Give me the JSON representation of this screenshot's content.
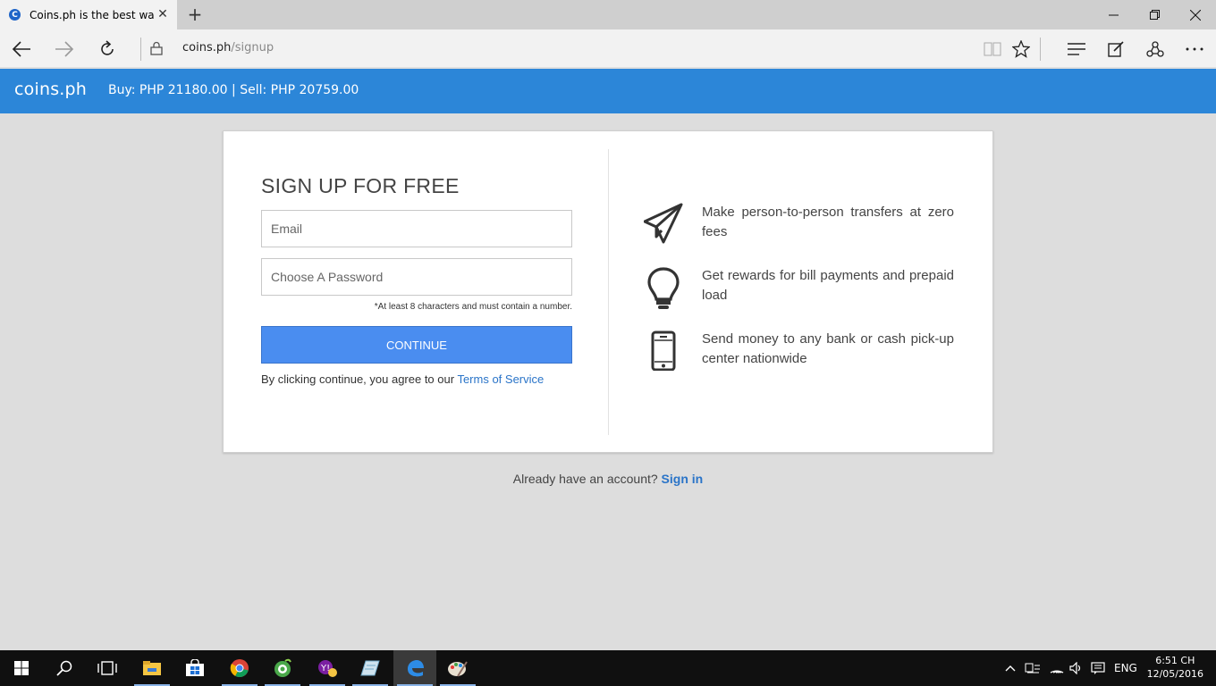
{
  "browser": {
    "tab_title": "Coins.ph is the best way",
    "favicon_letter": "C",
    "url_host": "coins.ph",
    "url_path": "/signup"
  },
  "site": {
    "logo": "coins.ph",
    "price_ticker": "Buy: PHP 21180.00 | Sell: PHP 20759.00",
    "brand_color": "#2c86d8"
  },
  "signup": {
    "heading": "SIGN UP FOR FREE",
    "email_placeholder": "Email",
    "password_placeholder": "Choose A Password",
    "password_hint": "*At least 8 characters and must contain a number.",
    "continue_label": "CONTINUE",
    "terms_prefix": "By clicking continue, you agree to our ",
    "terms_link": "Terms of Service"
  },
  "features": [
    {
      "icon": "paper-plane-icon",
      "text": "Make person-to-person transfers at zero fees"
    },
    {
      "icon": "lightbulb-icon",
      "text": "Get rewards for bill payments and prepaid load"
    },
    {
      "icon": "smartphone-icon",
      "text": "Send money to any bank or cash pick-up center nationwide"
    }
  ],
  "footer": {
    "already_text": "Already have an account? ",
    "sign_in_link": "Sign in"
  },
  "taskbar": {
    "language": "ENG",
    "time": "6:51 CH",
    "date": "12/05/2016"
  }
}
